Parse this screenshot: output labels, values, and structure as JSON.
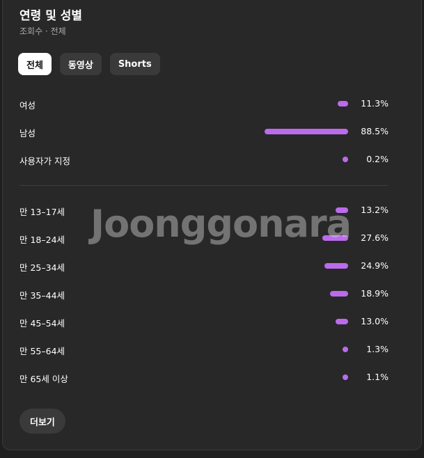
{
  "header": {
    "title": "연령 및 성별",
    "subtitle": "조회수 · 전체"
  },
  "tabs": [
    {
      "label": "전체",
      "active": true
    },
    {
      "label": "동영상",
      "active": false
    },
    {
      "label": "Shorts",
      "active": false
    }
  ],
  "gender": [
    {
      "label": "여성",
      "value": "11.3%",
      "percent": 11.3
    },
    {
      "label": "남성",
      "value": "88.5%",
      "percent": 88.5
    },
    {
      "label": "사용자가 지정",
      "value": "0.2%",
      "percent": 0.2
    }
  ],
  "age": [
    {
      "label": "만 13–17세",
      "value": "13.2%",
      "percent": 13.2
    },
    {
      "label": "만 18–24세",
      "value": "27.6%",
      "percent": 27.6
    },
    {
      "label": "만 25–34세",
      "value": "24.9%",
      "percent": 24.9
    },
    {
      "label": "만 35–44세",
      "value": "18.9%",
      "percent": 18.9
    },
    {
      "label": "만 45–54세",
      "value": "13.0%",
      "percent": 13.0
    },
    {
      "label": "만 55–64세",
      "value": "1.3%",
      "percent": 1.3
    },
    {
      "label": "만 65세 이상",
      "value": "1.1%",
      "percent": 1.1
    }
  ],
  "more_button": "더보기",
  "watermark": "Joonggonara",
  "colors": {
    "bar": "#bb6bec",
    "background": "#282828",
    "tab_active_bg": "#ffffff"
  }
}
